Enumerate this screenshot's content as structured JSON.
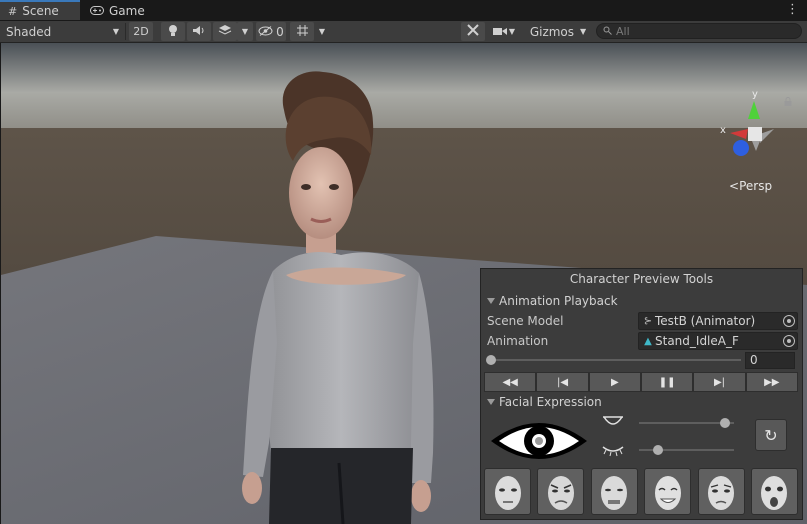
{
  "tabs": [
    {
      "label": "Scene",
      "icon": "grid-icon",
      "active": true
    },
    {
      "label": "Game",
      "icon": "gamepad-icon",
      "active": false
    }
  ],
  "toolbar": {
    "shading_mode": "Shaded",
    "btn_2d": "2D",
    "hidden_count": "0",
    "gizmos_label": "Gizmos",
    "search_placeholder": "All"
  },
  "scene": {
    "projection_label": "Persp",
    "axis_labels": {
      "x": "x",
      "y": "y"
    }
  },
  "panel": {
    "title": "Character Preview Tools",
    "playback": {
      "header": "Animation Playback",
      "scene_model_label": "Scene Model",
      "scene_model_value": "TestB (Animator)",
      "animation_label": "Animation",
      "animation_value": "Stand_IdleA_F",
      "frame_value": "0",
      "timeline_progress": 0
    },
    "facial": {
      "header": "Facial Expression",
      "eye_open_level": 0.9,
      "eye_closed_level": 0.2
    }
  },
  "colors": {
    "accent": "#3a79bb",
    "gizmo_y": "#4fd13a",
    "gizmo_x": "#d23a3a",
    "gizmo_z": "#2e5fe0"
  }
}
